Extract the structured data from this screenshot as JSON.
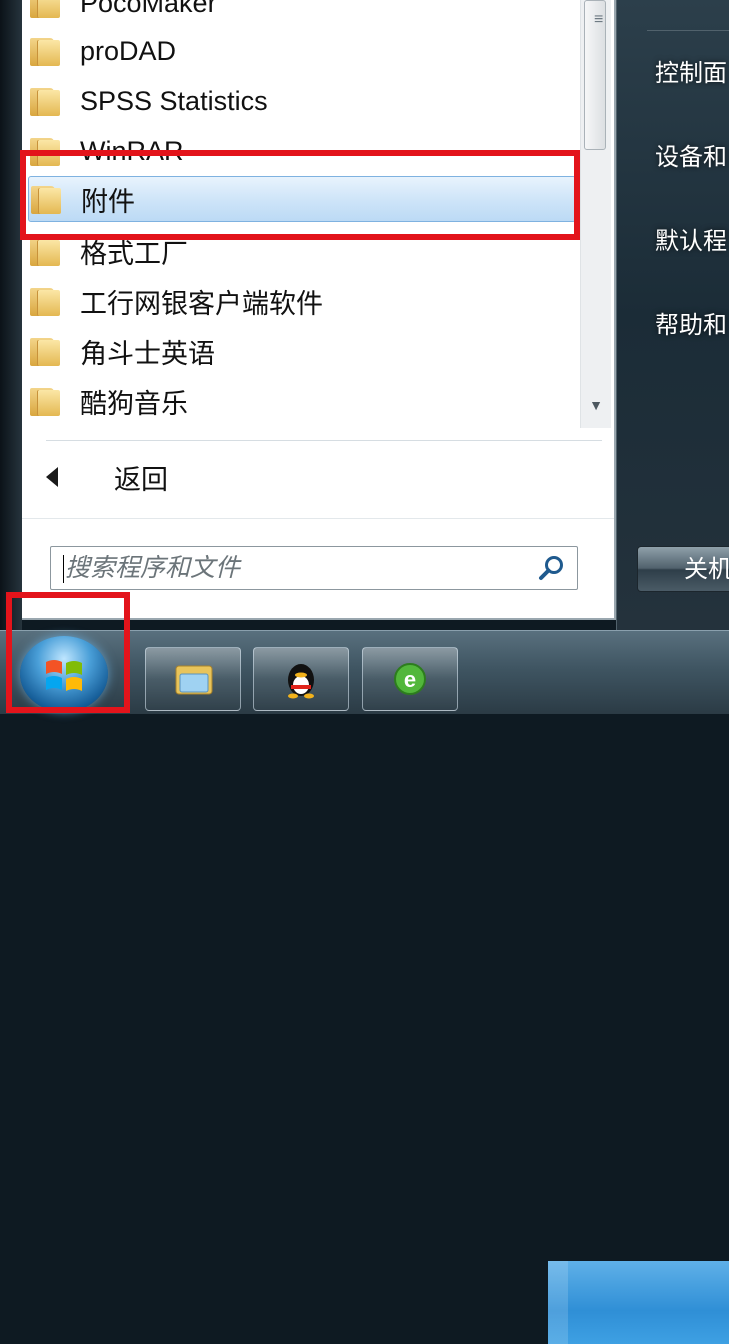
{
  "program_list": {
    "items": [
      {
        "label": "PocoMaker"
      },
      {
        "label": "proDAD"
      },
      {
        "label": "SPSS Statistics"
      },
      {
        "label": "WinRAR"
      },
      {
        "label": "附件",
        "selected": true
      },
      {
        "label": "格式工厂"
      },
      {
        "label": "工行网银客户端软件"
      },
      {
        "label": "角斗士英语"
      },
      {
        "label": "酷狗音乐"
      }
    ]
  },
  "back": {
    "label": "返回"
  },
  "search": {
    "placeholder": "搜索程序和文件"
  },
  "right_pane": {
    "items": [
      {
        "label": "控制面"
      },
      {
        "label": "设备和"
      },
      {
        "label": "默认程"
      },
      {
        "label": "帮助和"
      }
    ],
    "shutdown_label": "关机"
  },
  "taskbar": {
    "pinned": [
      {
        "icon": "explorer-icon"
      },
      {
        "icon": "qq-icon"
      },
      {
        "icon": "ie-browser-icon"
      }
    ]
  },
  "annotations": {
    "highlight_color": "#e3141b"
  }
}
